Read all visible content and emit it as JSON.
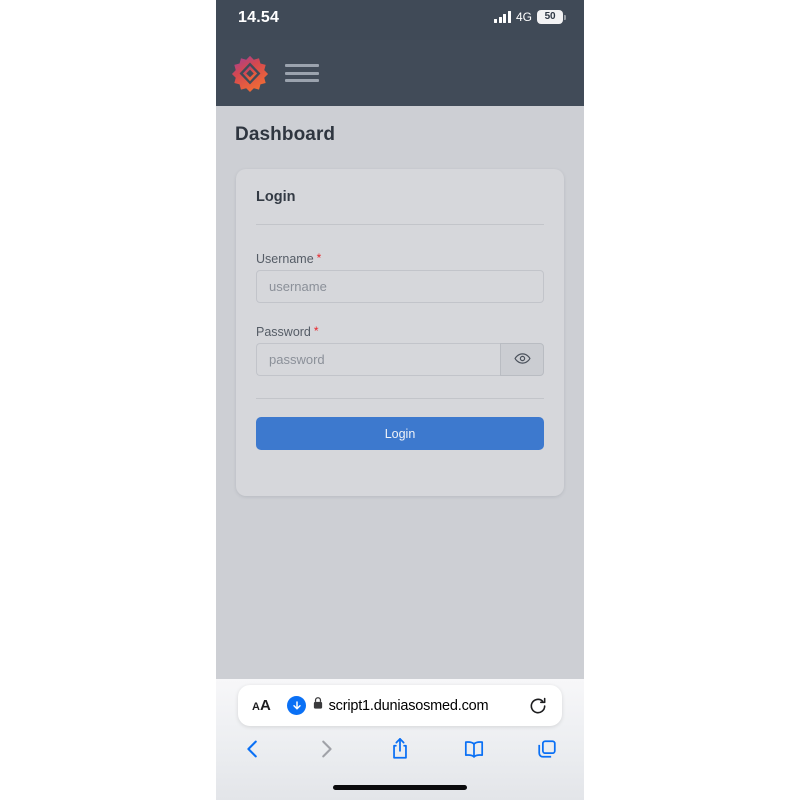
{
  "status_bar": {
    "time": "14.54",
    "network_label": "4G",
    "battery_percent": "50",
    "signal_icon": "cellular-signal-icon",
    "battery_icon": "battery-icon"
  },
  "app_bar": {
    "logo_icon": "app-logo-cog-icon",
    "menu_icon": "hamburger-menu-icon",
    "background_color": "#414b58"
  },
  "page": {
    "title": "Dashboard",
    "background_color": "#cdcfd4"
  },
  "login_card": {
    "title": "Login",
    "background_color": "#d6d7db",
    "username": {
      "label": "Username",
      "required_marker": "*",
      "placeholder": "username",
      "value": ""
    },
    "password": {
      "label": "Password",
      "required_marker": "*",
      "placeholder": "password",
      "value": "",
      "toggle_icon": "eye-icon"
    },
    "submit_label": "Login",
    "submit_color": "#3d79ce",
    "required_color": "#e8242a"
  },
  "browser": {
    "url": "script1.duniasosmed.com",
    "text_size_label_small": "A",
    "text_size_label_big": "A",
    "text_size_icon": "text-size-aa-icon",
    "downloads_icon": "downloads-arrow-icon",
    "lock_icon": "lock-icon",
    "reload_icon": "reload-icon",
    "accent_color": "#0a70f5",
    "toolbar": {
      "back_icon": "back-chevron-icon",
      "forward_icon": "forward-chevron-icon",
      "share_icon": "share-icon",
      "bookmarks_icon": "bookmarks-book-icon",
      "tabs_icon": "tabs-icon",
      "back_enabled": true,
      "forward_enabled": false
    },
    "home_indicator": "home-indicator"
  }
}
